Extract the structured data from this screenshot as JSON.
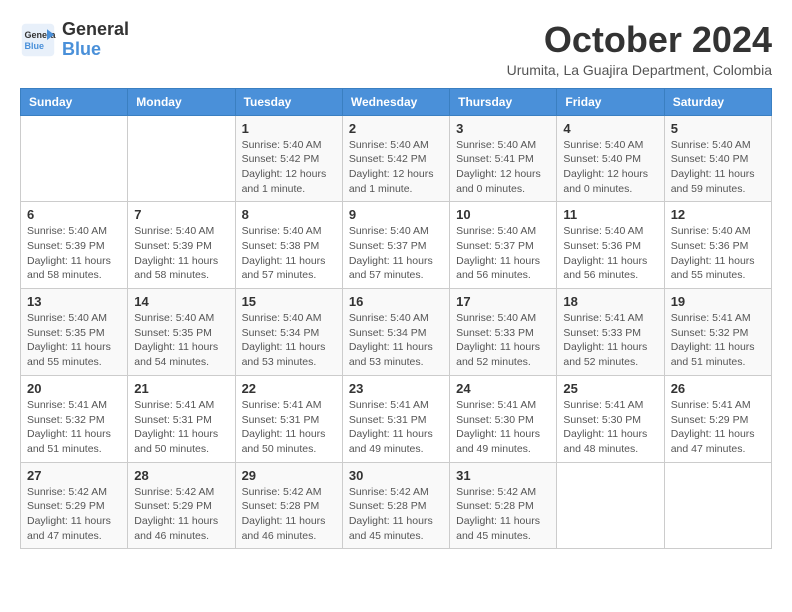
{
  "logo": {
    "line1": "General",
    "line2": "Blue"
  },
  "title": "October 2024",
  "subtitle": "Urumita, La Guajira Department, Colombia",
  "weekdays": [
    "Sunday",
    "Monday",
    "Tuesday",
    "Wednesday",
    "Thursday",
    "Friday",
    "Saturday"
  ],
  "weeks": [
    [
      {
        "day": "",
        "sunrise": "",
        "sunset": "",
        "daylight": ""
      },
      {
        "day": "",
        "sunrise": "",
        "sunset": "",
        "daylight": ""
      },
      {
        "day": "1",
        "sunrise": "Sunrise: 5:40 AM",
        "sunset": "Sunset: 5:42 PM",
        "daylight": "Daylight: 12 hours and 1 minute."
      },
      {
        "day": "2",
        "sunrise": "Sunrise: 5:40 AM",
        "sunset": "Sunset: 5:42 PM",
        "daylight": "Daylight: 12 hours and 1 minute."
      },
      {
        "day": "3",
        "sunrise": "Sunrise: 5:40 AM",
        "sunset": "Sunset: 5:41 PM",
        "daylight": "Daylight: 12 hours and 0 minutes."
      },
      {
        "day": "4",
        "sunrise": "Sunrise: 5:40 AM",
        "sunset": "Sunset: 5:40 PM",
        "daylight": "Daylight: 12 hours and 0 minutes."
      },
      {
        "day": "5",
        "sunrise": "Sunrise: 5:40 AM",
        "sunset": "Sunset: 5:40 PM",
        "daylight": "Daylight: 11 hours and 59 minutes."
      }
    ],
    [
      {
        "day": "6",
        "sunrise": "Sunrise: 5:40 AM",
        "sunset": "Sunset: 5:39 PM",
        "daylight": "Daylight: 11 hours and 58 minutes."
      },
      {
        "day": "7",
        "sunrise": "Sunrise: 5:40 AM",
        "sunset": "Sunset: 5:39 PM",
        "daylight": "Daylight: 11 hours and 58 minutes."
      },
      {
        "day": "8",
        "sunrise": "Sunrise: 5:40 AM",
        "sunset": "Sunset: 5:38 PM",
        "daylight": "Daylight: 11 hours and 57 minutes."
      },
      {
        "day": "9",
        "sunrise": "Sunrise: 5:40 AM",
        "sunset": "Sunset: 5:37 PM",
        "daylight": "Daylight: 11 hours and 57 minutes."
      },
      {
        "day": "10",
        "sunrise": "Sunrise: 5:40 AM",
        "sunset": "Sunset: 5:37 PM",
        "daylight": "Daylight: 11 hours and 56 minutes."
      },
      {
        "day": "11",
        "sunrise": "Sunrise: 5:40 AM",
        "sunset": "Sunset: 5:36 PM",
        "daylight": "Daylight: 11 hours and 56 minutes."
      },
      {
        "day": "12",
        "sunrise": "Sunrise: 5:40 AM",
        "sunset": "Sunset: 5:36 PM",
        "daylight": "Daylight: 11 hours and 55 minutes."
      }
    ],
    [
      {
        "day": "13",
        "sunrise": "Sunrise: 5:40 AM",
        "sunset": "Sunset: 5:35 PM",
        "daylight": "Daylight: 11 hours and 55 minutes."
      },
      {
        "day": "14",
        "sunrise": "Sunrise: 5:40 AM",
        "sunset": "Sunset: 5:35 PM",
        "daylight": "Daylight: 11 hours and 54 minutes."
      },
      {
        "day": "15",
        "sunrise": "Sunrise: 5:40 AM",
        "sunset": "Sunset: 5:34 PM",
        "daylight": "Daylight: 11 hours and 53 minutes."
      },
      {
        "day": "16",
        "sunrise": "Sunrise: 5:40 AM",
        "sunset": "Sunset: 5:34 PM",
        "daylight": "Daylight: 11 hours and 53 minutes."
      },
      {
        "day": "17",
        "sunrise": "Sunrise: 5:40 AM",
        "sunset": "Sunset: 5:33 PM",
        "daylight": "Daylight: 11 hours and 52 minutes."
      },
      {
        "day": "18",
        "sunrise": "Sunrise: 5:41 AM",
        "sunset": "Sunset: 5:33 PM",
        "daylight": "Daylight: 11 hours and 52 minutes."
      },
      {
        "day": "19",
        "sunrise": "Sunrise: 5:41 AM",
        "sunset": "Sunset: 5:32 PM",
        "daylight": "Daylight: 11 hours and 51 minutes."
      }
    ],
    [
      {
        "day": "20",
        "sunrise": "Sunrise: 5:41 AM",
        "sunset": "Sunset: 5:32 PM",
        "daylight": "Daylight: 11 hours and 51 minutes."
      },
      {
        "day": "21",
        "sunrise": "Sunrise: 5:41 AM",
        "sunset": "Sunset: 5:31 PM",
        "daylight": "Daylight: 11 hours and 50 minutes."
      },
      {
        "day": "22",
        "sunrise": "Sunrise: 5:41 AM",
        "sunset": "Sunset: 5:31 PM",
        "daylight": "Daylight: 11 hours and 50 minutes."
      },
      {
        "day": "23",
        "sunrise": "Sunrise: 5:41 AM",
        "sunset": "Sunset: 5:31 PM",
        "daylight": "Daylight: 11 hours and 49 minutes."
      },
      {
        "day": "24",
        "sunrise": "Sunrise: 5:41 AM",
        "sunset": "Sunset: 5:30 PM",
        "daylight": "Daylight: 11 hours and 49 minutes."
      },
      {
        "day": "25",
        "sunrise": "Sunrise: 5:41 AM",
        "sunset": "Sunset: 5:30 PM",
        "daylight": "Daylight: 11 hours and 48 minutes."
      },
      {
        "day": "26",
        "sunrise": "Sunrise: 5:41 AM",
        "sunset": "Sunset: 5:29 PM",
        "daylight": "Daylight: 11 hours and 47 minutes."
      }
    ],
    [
      {
        "day": "27",
        "sunrise": "Sunrise: 5:42 AM",
        "sunset": "Sunset: 5:29 PM",
        "daylight": "Daylight: 11 hours and 47 minutes."
      },
      {
        "day": "28",
        "sunrise": "Sunrise: 5:42 AM",
        "sunset": "Sunset: 5:29 PM",
        "daylight": "Daylight: 11 hours and 46 minutes."
      },
      {
        "day": "29",
        "sunrise": "Sunrise: 5:42 AM",
        "sunset": "Sunset: 5:28 PM",
        "daylight": "Daylight: 11 hours and 46 minutes."
      },
      {
        "day": "30",
        "sunrise": "Sunrise: 5:42 AM",
        "sunset": "Sunset: 5:28 PM",
        "daylight": "Daylight: 11 hours and 45 minutes."
      },
      {
        "day": "31",
        "sunrise": "Sunrise: 5:42 AM",
        "sunset": "Sunset: 5:28 PM",
        "daylight": "Daylight: 11 hours and 45 minutes."
      },
      {
        "day": "",
        "sunrise": "",
        "sunset": "",
        "daylight": ""
      },
      {
        "day": "",
        "sunrise": "",
        "sunset": "",
        "daylight": ""
      }
    ]
  ]
}
